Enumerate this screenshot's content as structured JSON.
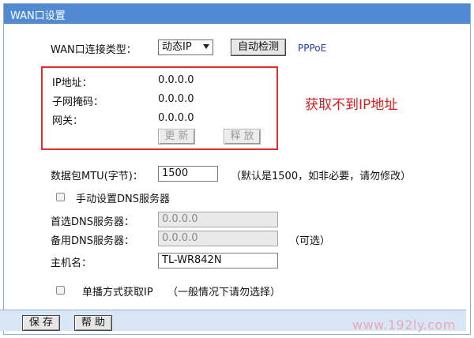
{
  "title": "WAN口设置",
  "connection": {
    "label": "WAN口连接类型：",
    "selected": "动态IP",
    "detect_label": "自动检测",
    "detected": "PPPoE"
  },
  "status": {
    "ip_label": "IP地址：",
    "ip_value": "0.0.0.0",
    "mask_label": "子网掩码：",
    "mask_value": "0.0.0.0",
    "gateway_label": "网关：",
    "gateway_value": "0.0.0.0",
    "renew_label": "更 新",
    "release_label": "释 放"
  },
  "annotation": "获取不到IP地址",
  "mtu": {
    "label": "数据包MTU(字节)：",
    "value": "1500",
    "hint": "（默认是1500，如非必要，请勿修改）"
  },
  "dns": {
    "manual_label": "手动设置DNS服务器",
    "primary_label": "首选DNS服务器：",
    "primary_value": "0.0.0.0",
    "secondary_label": "备用DNS服务器：",
    "secondary_value": "0.0.0.0",
    "optional_note": "（可选）"
  },
  "hostname": {
    "label": "主机名：",
    "value": "TL-WR842N"
  },
  "unicast": {
    "label": "单播方式获取IP",
    "note": "（一般情况下请勿选择）"
  },
  "footer": {
    "save_label": "保 存",
    "help_label": "帮 助"
  },
  "watermark": "www.192ly.com"
}
